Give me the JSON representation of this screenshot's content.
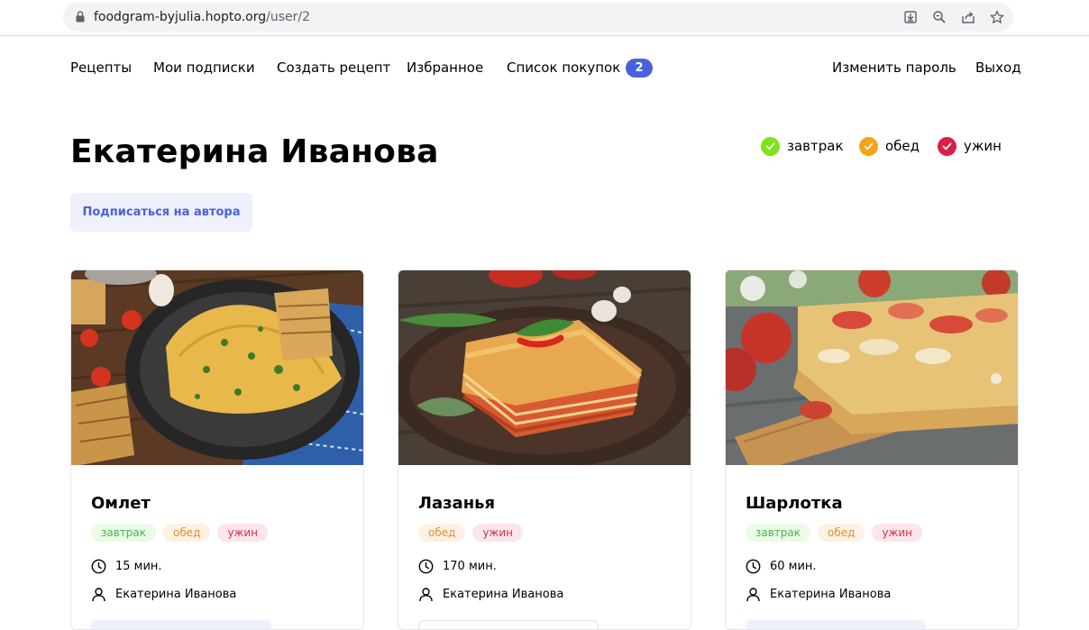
{
  "browser": {
    "url_host": "foodgram-byjulia.hopto.org",
    "url_path": "/user/2",
    "icons": [
      "lock-icon",
      "download-icon",
      "zoom-icon",
      "share-icon",
      "star-icon"
    ]
  },
  "nav": {
    "recipes": "Рецепты",
    "subscriptions": "Мои подписки",
    "create": "Создать рецепт",
    "favorites": "Избранное",
    "shopping_list": "Список покупок",
    "shopping_count": "2",
    "change_password": "Изменить пароль",
    "logout": "Выход"
  },
  "profile": {
    "name": "Екатерина Иванова",
    "subscribe_label": "Подписаться на автора"
  },
  "filters": [
    {
      "label": "завтрак",
      "color": "#7ee41a"
    },
    {
      "label": "обед",
      "color": "#f5a416"
    },
    {
      "label": "ужин",
      "color": "#d91e48"
    }
  ],
  "recipes": [
    {
      "title": "Омлет",
      "tags": [
        "завтрак",
        "обед",
        "ужин"
      ],
      "time": "15 мин.",
      "author": "Екатерина Иванова"
    },
    {
      "title": "Лазанья",
      "tags": [
        "обед",
        "ужин"
      ],
      "time": "170 мин.",
      "author": "Екатерина Иванова"
    },
    {
      "title": "Шарлотка",
      "tags": [
        "завтрак",
        "обед",
        "ужин"
      ],
      "time": "60 мин.",
      "author": "Екатерина Иванова"
    }
  ],
  "colors": {
    "accent": "#4a61dd",
    "breakfast": "#49b64e",
    "lunch": "#e29032",
    "dinner": "#d0344b"
  }
}
